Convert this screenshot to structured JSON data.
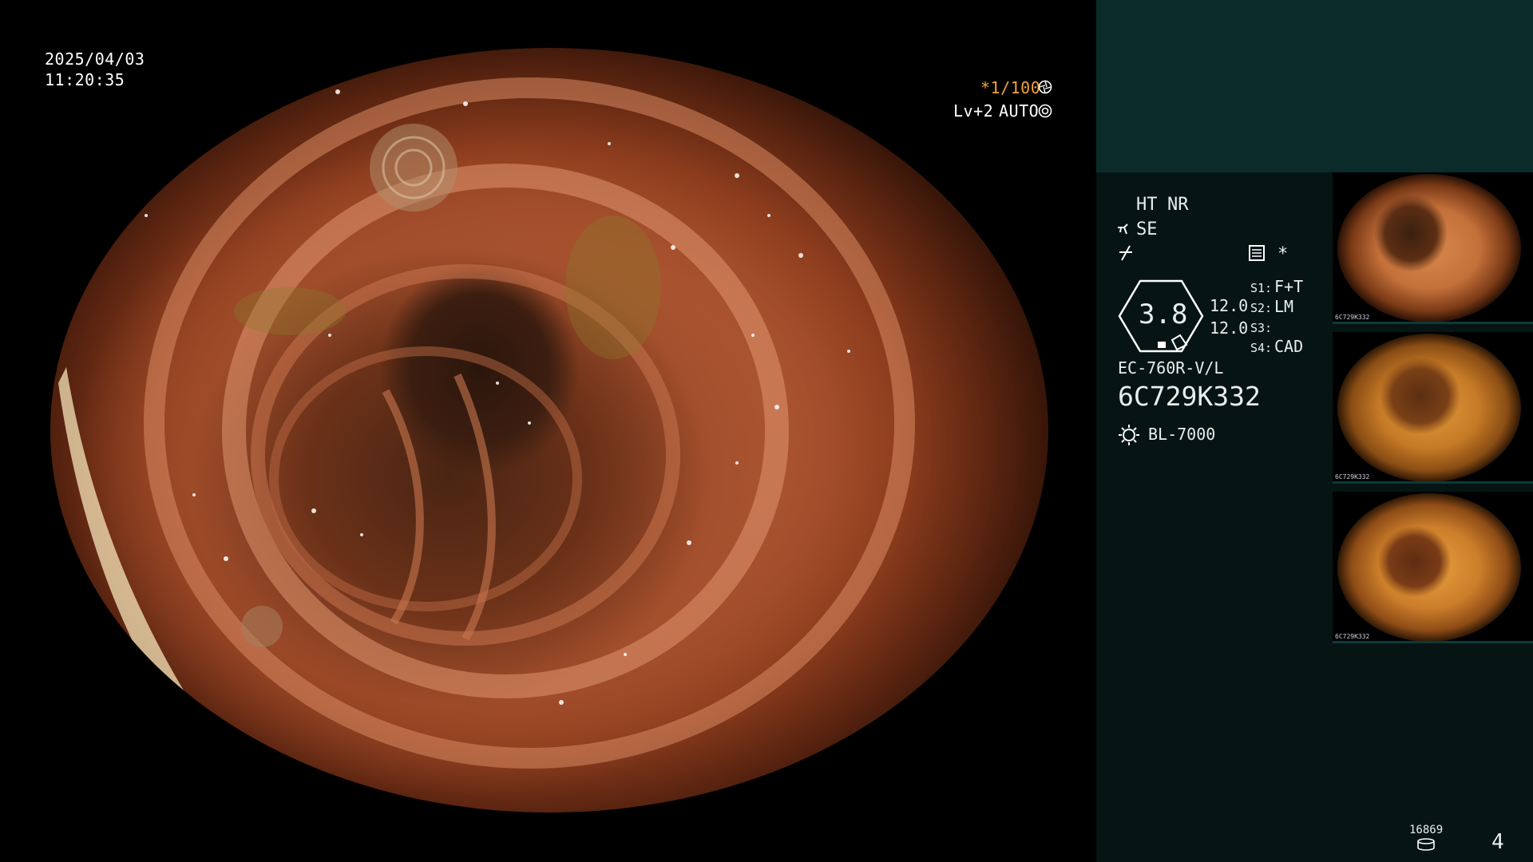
{
  "overlay": {
    "date": "2025/04/03",
    "time": "11:20:35",
    "shutter": "*1/100",
    "level": "Lv+2",
    "mode": "AUTO"
  },
  "settings": {
    "ht": "HT",
    "nr": "NR",
    "se": "SE",
    "zoom": "3.8",
    "value_top": "12.0",
    "value_bottom": "12.0",
    "s1_label": "S1:",
    "s1_value": "F+T",
    "s2_label": "S2:",
    "s2_value": "LM",
    "s3_label": "S3:",
    "s3_value": "",
    "s4_label": "S4:",
    "s4_value": "CAD",
    "asterisk": "*"
  },
  "scope": {
    "model": "EC-760R-V/L",
    "serial": "6C729K332"
  },
  "light_source": {
    "model": "BL-7000"
  },
  "thumbnails": [
    {
      "caption": "6C729K332"
    },
    {
      "caption": "6C729K332"
    },
    {
      "caption": "6C729K332"
    }
  ],
  "footer": {
    "storage_count": "16869",
    "image_count": "4"
  },
  "icons": {
    "shutter": "aperture-icon",
    "auto": "gear-icon",
    "scope_tip": "scope-tip-icon",
    "knife": "electrode-icon",
    "memo": "memo-icon",
    "lamp": "lamp-icon",
    "storage": "storage-icon"
  },
  "colors": {
    "accent": "#f0a23a",
    "panel_bg": "#061414",
    "panel_top": "#0b2b2b"
  }
}
